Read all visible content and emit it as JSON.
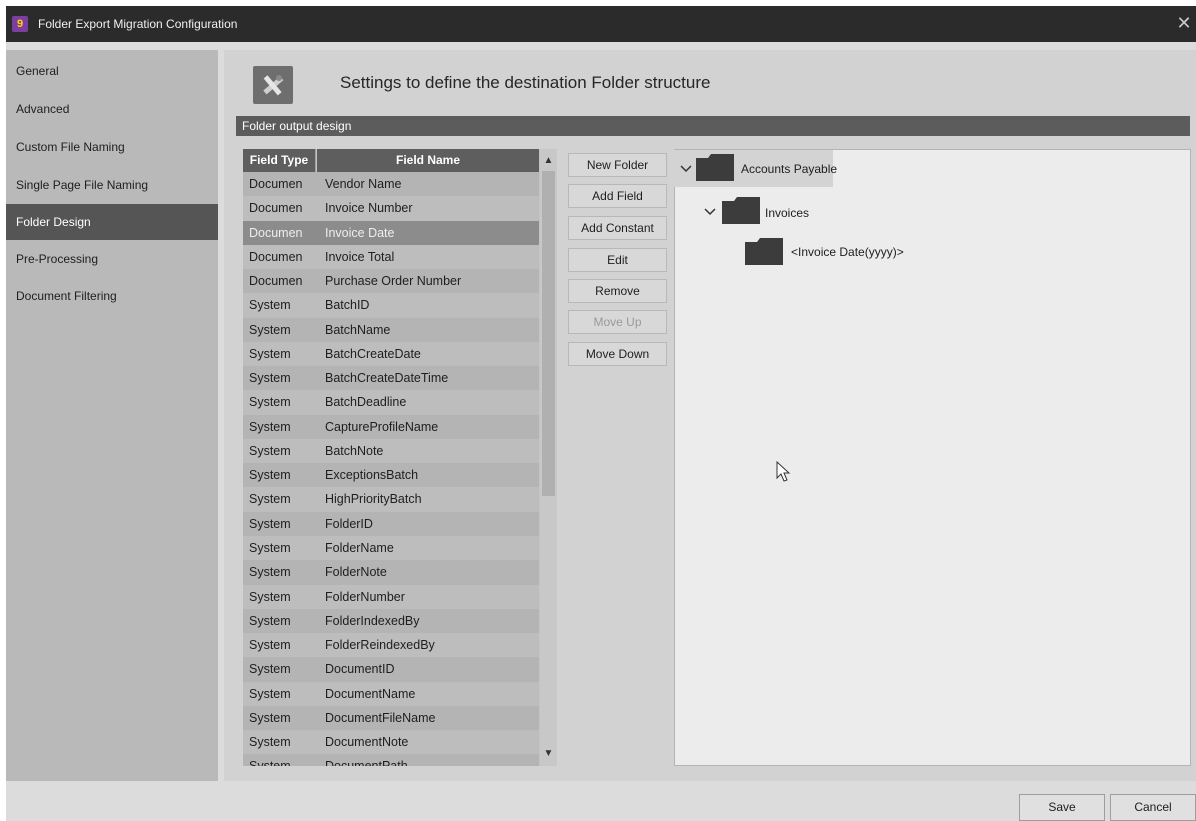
{
  "window": {
    "title": "Folder Export Migration Configuration",
    "app_icon_glyph": "9",
    "close_label": "✕"
  },
  "sidebar": {
    "items": [
      {
        "label": "General",
        "active": false
      },
      {
        "label": "Advanced",
        "active": false
      },
      {
        "label": "Custom File Naming",
        "active": false
      },
      {
        "label": "Single Page File Naming",
        "active": false
      },
      {
        "label": "Folder Design",
        "active": true
      },
      {
        "label": "Pre-Processing",
        "active": false
      },
      {
        "label": "Document Filtering",
        "active": false
      }
    ]
  },
  "header": {
    "title": "Settings to define the destination Folder structure",
    "icon": "tools-icon"
  },
  "group": {
    "title": "Folder output design"
  },
  "grid": {
    "columns": [
      "Field Type",
      "Field Name"
    ],
    "rows": [
      {
        "type": "Documen",
        "name": "Vendor Name"
      },
      {
        "type": "Documen",
        "name": "Invoice Number"
      },
      {
        "type": "Documen",
        "name": "Invoice Date",
        "selected": true
      },
      {
        "type": "Documen",
        "name": "Invoice Total"
      },
      {
        "type": "Documen",
        "name": "Purchase Order Number"
      },
      {
        "type": "System",
        "name": "BatchID"
      },
      {
        "type": "System",
        "name": "BatchName"
      },
      {
        "type": "System",
        "name": "BatchCreateDate"
      },
      {
        "type": "System",
        "name": "BatchCreateDateTime"
      },
      {
        "type": "System",
        "name": "BatchDeadline"
      },
      {
        "type": "System",
        "name": "CaptureProfileName"
      },
      {
        "type": "System",
        "name": "BatchNote"
      },
      {
        "type": "System",
        "name": "ExceptionsBatch"
      },
      {
        "type": "System",
        "name": "HighPriorityBatch"
      },
      {
        "type": "System",
        "name": "FolderID"
      },
      {
        "type": "System",
        "name": "FolderName"
      },
      {
        "type": "System",
        "name": "FolderNote"
      },
      {
        "type": "System",
        "name": "FolderNumber"
      },
      {
        "type": "System",
        "name": "FolderIndexedBy"
      },
      {
        "type": "System",
        "name": "FolderReindexedBy"
      },
      {
        "type": "System",
        "name": "DocumentID"
      },
      {
        "type": "System",
        "name": "DocumentName"
      },
      {
        "type": "System",
        "name": "DocumentFileName"
      },
      {
        "type": "System",
        "name": "DocumentNote"
      },
      {
        "type": "System",
        "name": "DocumentPath"
      }
    ],
    "scroll_up": "▲",
    "scroll_down": "▼"
  },
  "actions": {
    "new_folder": "New Folder",
    "add_field": "Add Field",
    "add_constant": "Add Constant",
    "edit": "Edit",
    "remove": "Remove",
    "move_up": "Move Up",
    "move_down": "Move Down",
    "move_up_disabled": true
  },
  "tree": {
    "root": {
      "label": "Accounts Payable",
      "expanded": true,
      "selected": true
    },
    "child": {
      "label": "Invoices",
      "expanded": true
    },
    "grandchild": {
      "label": "<Invoice Date(yyyy)>"
    }
  },
  "footer": {
    "save": "Save",
    "cancel": "Cancel"
  },
  "colors": {
    "title_bar": "#2b2b2b",
    "active_nav": "#555555",
    "group_bar": "#5c5c5c",
    "grid_header": "#5e5e5e",
    "app_icon": "#7b3fa0",
    "folder": "#3c3c3c"
  }
}
